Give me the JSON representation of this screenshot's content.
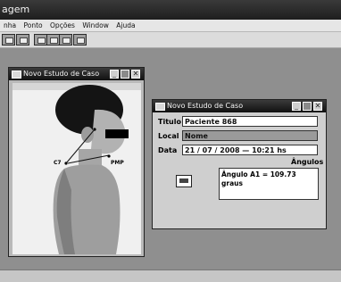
{
  "app": {
    "title": "agem"
  },
  "menu": [
    "nha",
    "Ponto",
    "Opções",
    "Window",
    "Ajuda"
  ],
  "photo_window": {
    "title": "Novo Estudo de Caso"
  },
  "photo_labels": {
    "c7": "C7",
    "pmp": "PMP"
  },
  "info_window": {
    "title": "Novo Estudo de Caso",
    "titulo_label": "Titulo",
    "titulo_value": "Paciente 868",
    "local_label": "Local",
    "local_value": "Nome",
    "data_label": "Data",
    "data_value": "21 / 07 / 2008  —  10:21 hs",
    "angulos_label": "Ângulos",
    "angulos_text": "Ângulo A1 = 109.73 graus"
  }
}
